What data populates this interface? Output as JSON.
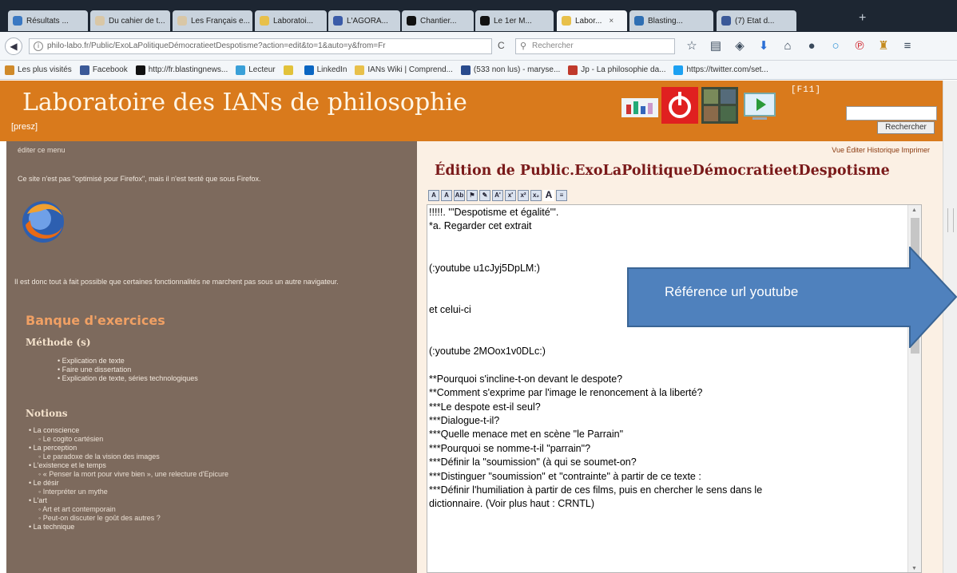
{
  "browser": {
    "tabs": [
      {
        "label": "Résultats ...",
        "color": "#3a78c2"
      },
      {
        "label": "Du cahier de t...",
        "color": "#d9c7a6"
      },
      {
        "label": "Les Français e...",
        "color": "#d9c7a6"
      },
      {
        "label": "Laboratoi...",
        "color": "#e8c04a"
      },
      {
        "label": "L'AGORA...",
        "color": "#3a5ba8"
      },
      {
        "label": "Chantier...",
        "color": "#111111"
      },
      {
        "label": "Le 1er M...",
        "color": "#111111"
      },
      {
        "label": "Labor...",
        "color": "#e8c04a"
      },
      {
        "label": "Blasting...",
        "color": "#2f6fb3"
      },
      {
        "label": "(7) Etat d...",
        "color": "#3b5998"
      }
    ],
    "url": "philo-labo.fr/Public/ExoLaPolitiqueDémocratieetDespotisme?action=edit&to=1&auto=y&from=Fr",
    "search_placeholder": "Rechercher",
    "toolbar_icons": [
      "star-icon",
      "reading-list-icon",
      "pocket-icon",
      "download-icon",
      "home-icon",
      "chat-icon",
      "circle-icon",
      "pinterest-icon",
      "extension-icon",
      "menu-icon"
    ],
    "bookmarks": [
      {
        "label": "Les plus visités",
        "color": "#d08a2a"
      },
      {
        "label": "Facebook",
        "color": "#3b5998"
      },
      {
        "label": "http://fr.blastingnews...",
        "color": "#111111"
      },
      {
        "label": "Lecteur",
        "color": "#3aa0d8"
      },
      {
        "label": "",
        "color": "#e2c23a"
      },
      {
        "label": "LinkedIn",
        "color": "#0a66c2"
      },
      {
        "label": "IANs Wiki | Comprend...",
        "color": "#e8c04a"
      },
      {
        "label": "(533 non lus) - maryse...",
        "color": "#2a4b8d"
      },
      {
        "label": "Jp - La philosophie da...",
        "color": "#c0392b"
      },
      {
        "label": "https://twitter.com/set...",
        "color": "#1da1f2"
      }
    ]
  },
  "site": {
    "title": "Laboratoire des IANs de philosophie",
    "presz": "[presz]",
    "f11": "[F11]",
    "search_button": "Rechercher"
  },
  "sidebar": {
    "edit_menu": "éditer ce menu",
    "note": "Ce site n'est pas \"optimisé pour Firefox\", mais il n'est testé que sous Firefox.",
    "note2": "Il est donc tout à fait possible que certaines fonctionnalités ne marchent pas sous un autre navigateur.",
    "banque": "Banque d'exercices",
    "methode_heading": "Méthode (s)",
    "methode_items": [
      "Explication de texte",
      "Faire une dissertation",
      "Explication de texte, séries technologiques"
    ],
    "notions_heading": "Notions",
    "notions": [
      {
        "text": "La conscience",
        "sub": false
      },
      {
        "text": "Le cogito cartésien",
        "sub": true
      },
      {
        "text": "La perception",
        "sub": false
      },
      {
        "text": "Le paradoxe de la vision des images",
        "sub": true
      },
      {
        "text": "L'existence et le temps",
        "sub": false
      },
      {
        "text": "« Penser la mort pour vivre bien », une relecture d'Epicure",
        "sub": true
      },
      {
        "text": "Le désir",
        "sub": false
      },
      {
        "text": "Interpréter un mythe",
        "sub": true
      },
      {
        "text": "L'art",
        "sub": false
      },
      {
        "text": "Art et art contemporain",
        "sub": true
      },
      {
        "text": "Peut-on discuter le goût des autres ?",
        "sub": true
      },
      {
        "text": "La technique",
        "sub": false
      }
    ]
  },
  "content": {
    "actions": "Vue Éditer Historique Imprimer",
    "edit_title": "Édition de Public.ExoLaPolitiqueDémocratieetDespotisme",
    "toolbar_buttons": [
      "A",
      "A",
      "Ab",
      "⚑",
      "✎",
      "A'",
      "x'",
      "x²",
      "x₂",
      "A",
      "≡"
    ],
    "editor_lines": [
      "!!!!!. '''Despotisme et égalité'''.",
      "*a. Regarder cet extrait",
      "",
      "",
      "(:youtube u1cJyj5DpLM:)",
      "",
      "",
      "et celui-ci",
      "",
      "",
      "(:youtube 2MOox1v0DLc:)",
      "",
      "**Pourquoi s'incline-t-on devant le despote?",
      "**Comment s'exprime par l'image le renoncement à la liberté?",
      "***Le despote est-il seul?",
      "***Dialogue-t-il?",
      "***Quelle menace met en scène \"le Parrain\"",
      "***Pourquoi se nomme-t-il \"parrain\"?",
      "***Définir la \"soumission\" (à qui se soumet-on?",
      "***Distinguer \"soumission\" et \"contrainte\" à partir de ce texte :",
      "***Définir l'humiliation à partir de ces films, puis en chercher le sens dans le",
      "dictionnaire. (Voir plus haut : CRNTL)"
    ]
  },
  "callout": {
    "text": "Référence url youtube",
    "color": "#4f81bd"
  }
}
